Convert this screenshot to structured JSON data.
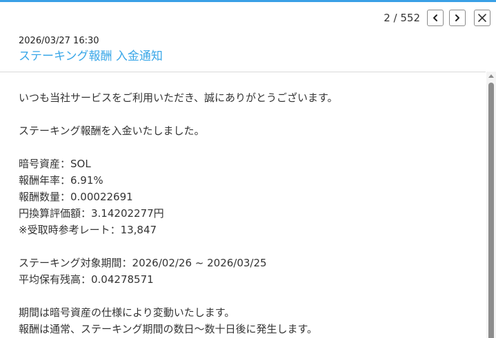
{
  "pager": {
    "count": "2 / 552"
  },
  "icons": {
    "prev": "chevron-left-icon",
    "next": "chevron-right-icon",
    "close": "close-icon"
  },
  "message": {
    "datetime": "2026/03/27 16:30",
    "subject": "ステーキング報酬 入金通知",
    "lines": {
      "greeting": "いつも当社サービスをご利用いただき、誠にありがとうございます。",
      "notice": "ステーキング報酬を入金いたしました。",
      "asset": "暗号資産：SOL",
      "rate": "報酬年率：6.91%",
      "amount": "報酬数量：0.00022691",
      "jpy_value": "円換算評価額：3.14202277円",
      "ref_rate": "※受取時参考レート：13,847",
      "period": "ステーキング対象期間：2026/02/26 ~ 2026/03/25",
      "avg_balance": "平均保有残高：0.04278571",
      "note1": "期間は暗号資産の仕様により変動いたします。",
      "note2": "報酬は通常、ステーキング期間の数日〜数十日後に発生します。"
    }
  },
  "colors": {
    "accent": "#3aa0e6",
    "subject": "#3aa7e8",
    "text": "#333333"
  }
}
